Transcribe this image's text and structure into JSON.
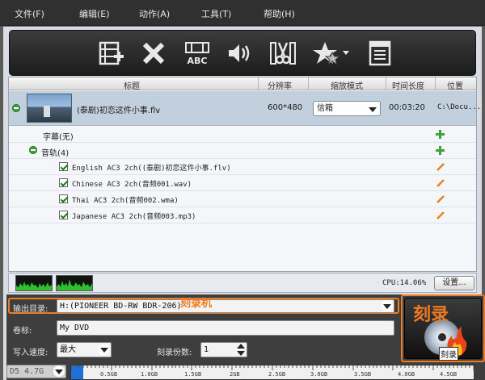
{
  "menu": {
    "items": [
      "文件(F)",
      "编辑(E)",
      "动作(A)",
      "工具(T)",
      "帮助(H)"
    ]
  },
  "toolbar": {
    "buttons": [
      "add-video-icon",
      "delete-icon",
      "subtitle-icon",
      "audio-icon",
      "cut-icon",
      "effects-icon",
      "properties-icon"
    ]
  },
  "table": {
    "headers": [
      "标题",
      "分辨率",
      "缩放模式",
      "时间长度",
      "位置"
    ],
    "file": {
      "title": "(泰剧)初恋这件小事.flv",
      "resolution": "600*480",
      "scale_mode": "信箱",
      "duration": "00:03:20",
      "location": "C:\\Docu..."
    },
    "subtitle_label": "字幕(无)",
    "audio_label": "音轨(4)",
    "tracks": [
      "English AC3 2ch((泰剧)初恋这件小事.flv)",
      "Chinese AC3 2ch(音频001.wav)",
      "Thai AC3 2ch(音频002.wma)",
      "Japanese AC3 2ch(音频003.mp3)"
    ]
  },
  "status": {
    "cpu": "CPU:14.06%",
    "settings_button": "设置..."
  },
  "output": {
    "dir_label": "输出目录:",
    "dir_value": "H:(PIONEER BD-RW   BDR-206)",
    "dir_annotation": "刻录机",
    "volume_label": "卷标:",
    "volume_value": "My DVD",
    "speed_label": "写入速度:",
    "speed_value": "最大",
    "copies_label": "刻录份数:",
    "copies_value": "1"
  },
  "burn": {
    "title": "刻录",
    "caption": "刻录"
  },
  "capacity": {
    "disc_type": "D5 4.7G",
    "used_fraction": 0.03,
    "ticks": [
      "0.5GB",
      "1.0GB",
      "1.5GB",
      "2GB",
      "2.5GB",
      "3.0GB",
      "3.5GB",
      "4.0GB",
      "4.5GB"
    ]
  },
  "colors": {
    "accent": "#f07b20",
    "selection": "#c2cfdd",
    "capacity_fill": "#1f6fd6",
    "cpu_graph": "#2fbf2f"
  }
}
